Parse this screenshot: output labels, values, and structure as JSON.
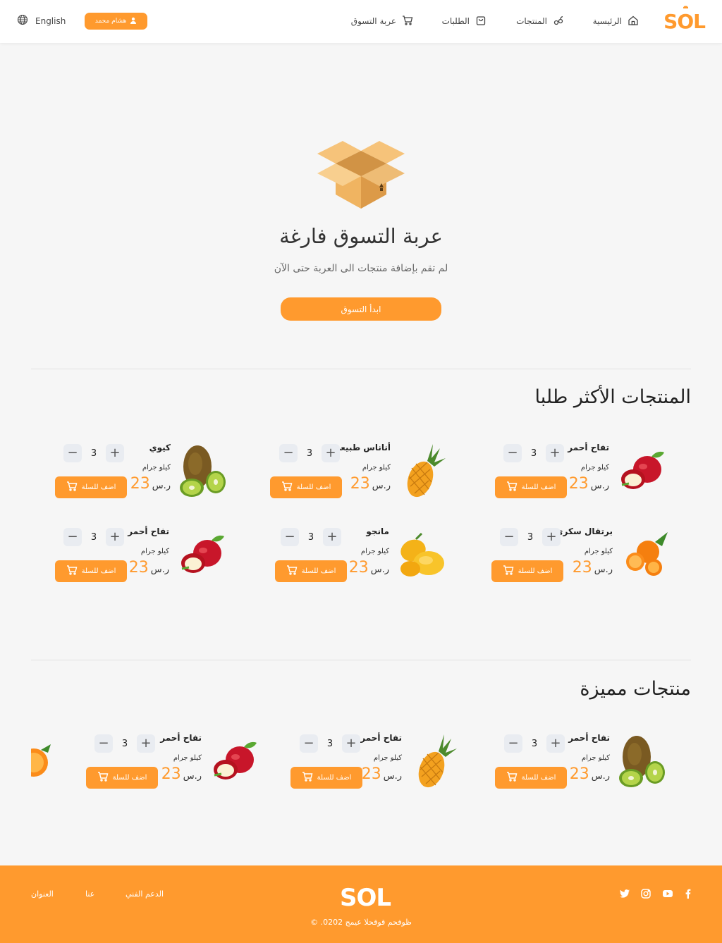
{
  "header": {
    "logo": "sol",
    "nav": [
      {
        "label": "الرئيسية",
        "icon": "home-icon"
      },
      {
        "label": "المنتجات",
        "icon": "products-icon"
      },
      {
        "label": "الطلبات",
        "icon": "bag-icon"
      },
      {
        "label": "عربة التسوق",
        "icon": "cart-icon"
      }
    ],
    "user_label": "هشام محمد",
    "language_label": "English"
  },
  "empty_cart": {
    "title": "عربة التسوق فارغة",
    "subtitle": "لم تقم بإضافة منتجات الى العربة حتى الآن",
    "button": "ابدأ التسوق"
  },
  "sections": {
    "popular_title": "المنتجات الأكثر طلبا",
    "featured_title": "منتجات مميزة"
  },
  "popular": [
    {
      "name": "تفاح أحمر",
      "unit": "كيلو جرام",
      "price": "23",
      "currency": "ر.س",
      "qty": "3",
      "add_label": "اضف للسلة",
      "fruit": "apple"
    },
    {
      "name": "أناناس طبيعي",
      "unit": "كيلو جرام",
      "price": "23",
      "currency": "ر.س",
      "qty": "3",
      "add_label": "اضف للسلة",
      "fruit": "pineapple"
    },
    {
      "name": "كيوي",
      "unit": "كيلو جرام",
      "price": "23",
      "currency": "ر.س",
      "qty": "3",
      "add_label": "اضف للسلة",
      "fruit": "kiwi"
    },
    {
      "name": "برتقال سكري",
      "unit": "كيلو جرام",
      "price": "23",
      "currency": "ر.س",
      "qty": "3",
      "add_label": "اضف للسلة",
      "fruit": "orange"
    },
    {
      "name": "مانجو",
      "unit": "كيلو جرام",
      "price": "23",
      "currency": "ر.س",
      "qty": "3",
      "add_label": "اضف للسلة",
      "fruit": "mango"
    },
    {
      "name": "تفاح أحمر",
      "unit": "كيلو جرام",
      "price": "23",
      "currency": "ر.س",
      "qty": "3",
      "add_label": "اضف للسلة",
      "fruit": "apple"
    }
  ],
  "featured": [
    {
      "name": "تفاح أحمر",
      "unit": "كيلو جرام",
      "price": "23",
      "currency": "ر.س",
      "qty": "3",
      "add_label": "اضف للسلة",
      "fruit": "kiwi"
    },
    {
      "name": "تفاح أحمر",
      "unit": "كيلو جرام",
      "price": "23",
      "currency": "ر.س",
      "qty": "3",
      "add_label": "اضف للسلة",
      "fruit": "pineapple"
    },
    {
      "name": "تفاح أحمر",
      "unit": "كيلو جرام",
      "price": "23",
      "currency": "ر.س",
      "qty": "3",
      "add_label": "اضف للسلة",
      "fruit": "apple"
    }
  ],
  "footer": {
    "logo": "sol",
    "links": [
      "الدعم الفني",
      "عنا",
      "العنوان"
    ],
    "copyright": "© .ظوفحم قوقحلا عيمج 0202",
    "social": [
      "twitter-icon",
      "instagram-icon",
      "youtube-icon",
      "facebook-icon"
    ]
  },
  "colors": {
    "accent": "#ff9a2e",
    "background": "#f6f6f6"
  }
}
